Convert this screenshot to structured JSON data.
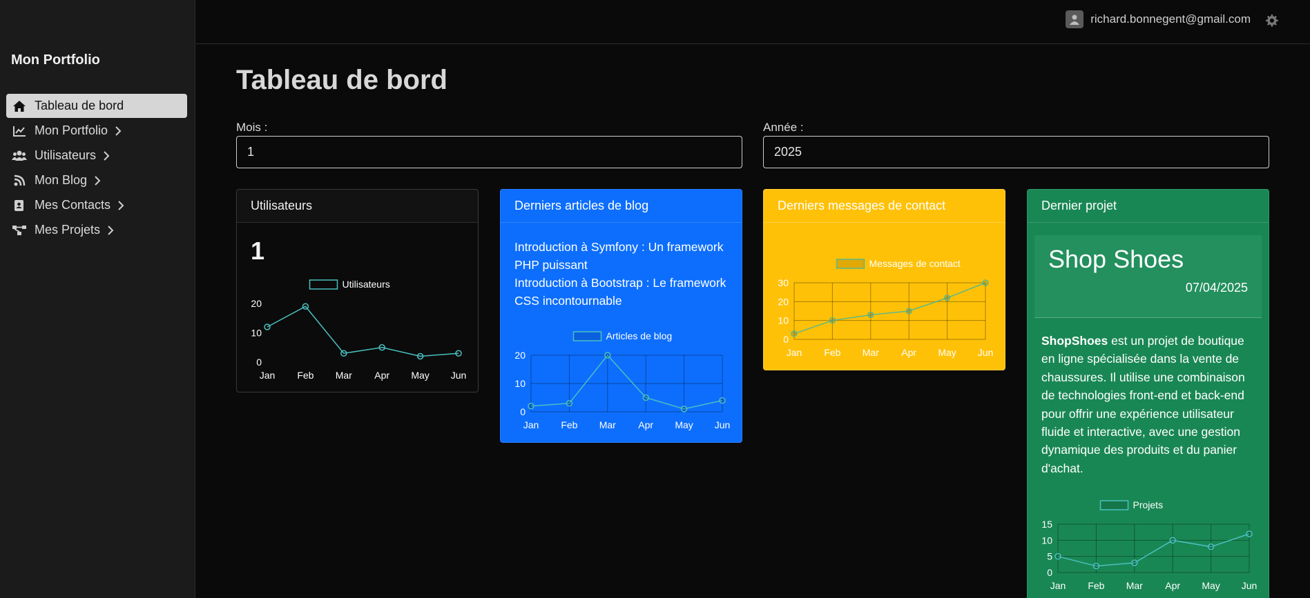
{
  "sidebar": {
    "brand": "Mon Portfolio",
    "items": [
      {
        "label": "Tableau de bord",
        "icon": "home-icon",
        "active": true
      },
      {
        "label": "Mon Portfolio",
        "icon": "line-chart-icon",
        "active": false
      },
      {
        "label": "Utilisateurs",
        "icon": "users-icon",
        "active": false
      },
      {
        "label": "Mon Blog",
        "icon": "blog-icon",
        "active": false
      },
      {
        "label": "Mes Contacts",
        "icon": "contact-book-icon",
        "active": false
      },
      {
        "label": "Mes Projets",
        "icon": "project-diagram-icon",
        "active": false
      }
    ]
  },
  "topbar": {
    "user_email": "richard.bonnegent@gmail.com",
    "avatar_icon": "user-avatar-icon",
    "settings_icon": "gear-icon"
  },
  "main": {
    "title": "Tableau de bord",
    "month": {
      "label": "Mois :",
      "value": "1"
    },
    "year": {
      "label": "Année :",
      "value": "2025"
    }
  },
  "cards": {
    "users": {
      "title": "Utilisateurs",
      "count": "1"
    },
    "blog": {
      "title": "Derniers articles de blog",
      "articles": [
        "Introduction à Symfony : Un framework PHP puissant",
        "Introduction à Bootstrap : Le framework CSS incontournable"
      ]
    },
    "contact": {
      "title": "Derniers messages de contact"
    },
    "project": {
      "title": "Dernier projet",
      "name": "Shop Shoes",
      "date": "07/04/2025",
      "desc_bold": "ShopShoes",
      "desc_rest": " est un projet de boutique en ligne spécialisée dans la vente de chaussures. Il utilise une combinaison de technologies front-end et back-end pour offrir une expérience utilisateur fluide et interactive, avec une gestion dynamique des produits et du panier d'achat."
    }
  },
  "colors": {
    "bg": "#0a0a0a",
    "sidebar": "#1b1b1b",
    "primary": "#0d6efd",
    "warning": "#ffc107",
    "success": "#198754",
    "line": "#4bc0c0"
  },
  "chart_data": [
    {
      "type": "line",
      "categories": [
        "Jan",
        "Feb",
        "Mar",
        "Apr",
        "May",
        "Jun"
      ],
      "series": [
        {
          "name": "Utilisateurs",
          "values": [
            12,
            19,
            3,
            5,
            2,
            3
          ]
        }
      ],
      "yticks": [
        0,
        10,
        20
      ],
      "ylim": [
        0,
        20
      ],
      "grid": false,
      "legend": "top"
    },
    {
      "type": "line",
      "categories": [
        "Jan",
        "Feb",
        "Mar",
        "Apr",
        "May",
        "Jun"
      ],
      "series": [
        {
          "name": "Articles de blog",
          "values": [
            2,
            3,
            20,
            5,
            1,
            4
          ]
        }
      ],
      "yticks": [
        0,
        10,
        20
      ],
      "ylim": [
        0,
        20
      ],
      "grid": true,
      "legend": "top"
    },
    {
      "type": "line",
      "categories": [
        "Jan",
        "Feb",
        "Mar",
        "Apr",
        "May",
        "Jun"
      ],
      "series": [
        {
          "name": "Messages de contact",
          "values": [
            3,
            10,
            13,
            15,
            22,
            30
          ]
        }
      ],
      "yticks": [
        0,
        10,
        20,
        30
      ],
      "ylim": [
        0,
        30
      ],
      "grid": true,
      "legend": "top"
    },
    {
      "type": "line",
      "categories": [
        "Jan",
        "Feb",
        "Mar",
        "Apr",
        "May",
        "Jun"
      ],
      "series": [
        {
          "name": "Projets",
          "values": [
            5,
            2,
            3,
            10,
            8,
            12
          ]
        }
      ],
      "yticks": [
        0,
        5,
        10,
        15
      ],
      "ylim": [
        0,
        15
      ],
      "grid": true,
      "legend": "top"
    }
  ]
}
